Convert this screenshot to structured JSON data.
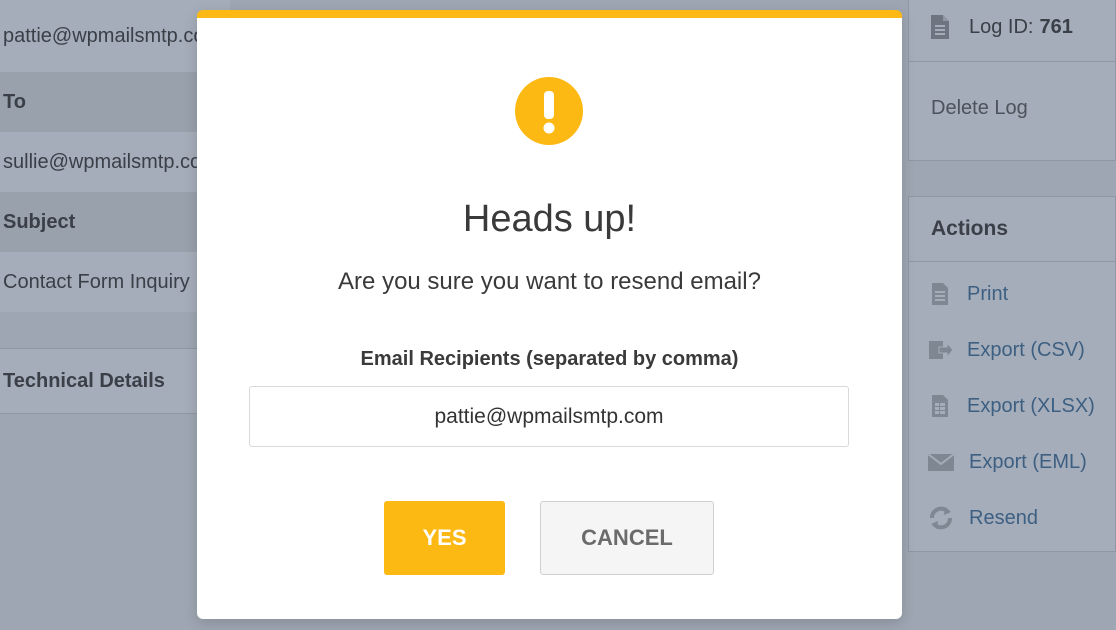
{
  "background": {
    "left_rows": {
      "from_value": "pattie@wpmailsmtp.com",
      "to_label": "To",
      "to_value": "sullie@wpmailsmtp.com",
      "subject_label": "Subject",
      "subject_value": "Contact Form Inquiry",
      "technical_details": "Technical Details"
    },
    "log_panel": {
      "log_id_label": "Log ID:",
      "log_id_value": "761",
      "delete_log": "Delete Log"
    },
    "actions_panel": {
      "title": "Actions",
      "items": [
        {
          "label": "Print",
          "icon": "print-icon"
        },
        {
          "label": "Export (CSV)",
          "icon": "export-icon"
        },
        {
          "label": "Export (XLSX)",
          "icon": "spreadsheet-icon"
        },
        {
          "label": "Export (EML)",
          "icon": "envelope-icon"
        },
        {
          "label": "Resend",
          "icon": "resend-icon"
        }
      ]
    }
  },
  "modal": {
    "title": "Heads up!",
    "message": "Are you sure you want to resend email?",
    "recipients_label": "Email Recipients (separated by comma)",
    "recipients_value": "pattie@wpmailsmtp.com",
    "yes_label": "YES",
    "cancel_label": "CANCEL",
    "accent_color": "#fdb913"
  }
}
